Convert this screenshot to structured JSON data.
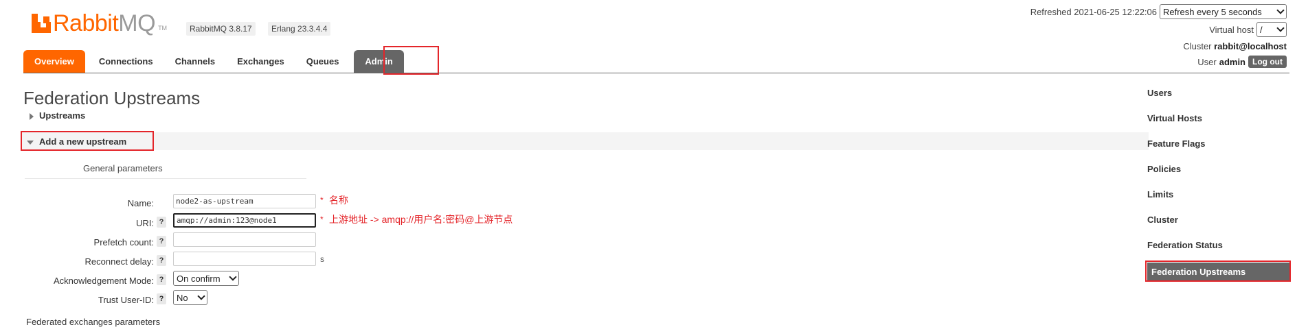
{
  "app": {
    "brand_main": "Rabbit",
    "brand_mq": "MQ",
    "brand_tm": "TM",
    "rabbitmq_version": "RabbitMQ 3.8.17",
    "erlang_version": "Erlang 23.3.4.4"
  },
  "header": {
    "refreshed_label": "Refreshed 2021-06-25 12:22:06",
    "refresh_select": "Refresh every 5 seconds",
    "virtual_host_label": "Virtual host",
    "virtual_host_value": "/",
    "cluster_label": "Cluster",
    "cluster_value": "rabbit@localhost",
    "user_label": "User",
    "user_value": "admin",
    "logout_label": "Log out"
  },
  "tabs": [
    {
      "label": "Overview",
      "state": "orange"
    },
    {
      "label": "Connections"
    },
    {
      "label": "Channels"
    },
    {
      "label": "Exchanges"
    },
    {
      "label": "Queues"
    },
    {
      "label": "Admin",
      "state": "active"
    }
  ],
  "main": {
    "page_title": "Federation Upstreams",
    "upstreams_section": "Upstreams",
    "add_section": "Add a new upstream",
    "general_parameters": "General parameters",
    "federated_exchanges_parameters": "Federated exchanges parameters",
    "form": {
      "name_label": "Name:",
      "name_value": "node2-as-upstream",
      "name_annotation": "名称",
      "uri_label": "URI:",
      "uri_value": "amqp://admin:123@node1",
      "uri_annotation": "上游地址 -> amqp://用户名:密码@上游节点",
      "prefetch_label": "Prefetch count:",
      "prefetch_value": "",
      "reconnect_label": "Reconnect delay:",
      "reconnect_value": "",
      "reconnect_unit": "s",
      "ack_label": "Acknowledgement Mode:",
      "ack_value": "On confirm",
      "trust_label": "Trust User-ID:",
      "trust_value": "No",
      "help_glyph": "?",
      "required_glyph": "*"
    }
  },
  "sidebar": {
    "items": [
      {
        "label": "Users"
      },
      {
        "label": "Virtual Hosts"
      },
      {
        "label": "Feature Flags"
      },
      {
        "label": "Policies"
      },
      {
        "label": "Limits"
      },
      {
        "label": "Cluster"
      },
      {
        "label": "Federation Status"
      },
      {
        "label": "Federation Upstreams",
        "active": true
      }
    ]
  },
  "colors": {
    "accent_orange": "#ff6600",
    "active_gray": "#666666",
    "annotation_red": "#e4252a"
  }
}
